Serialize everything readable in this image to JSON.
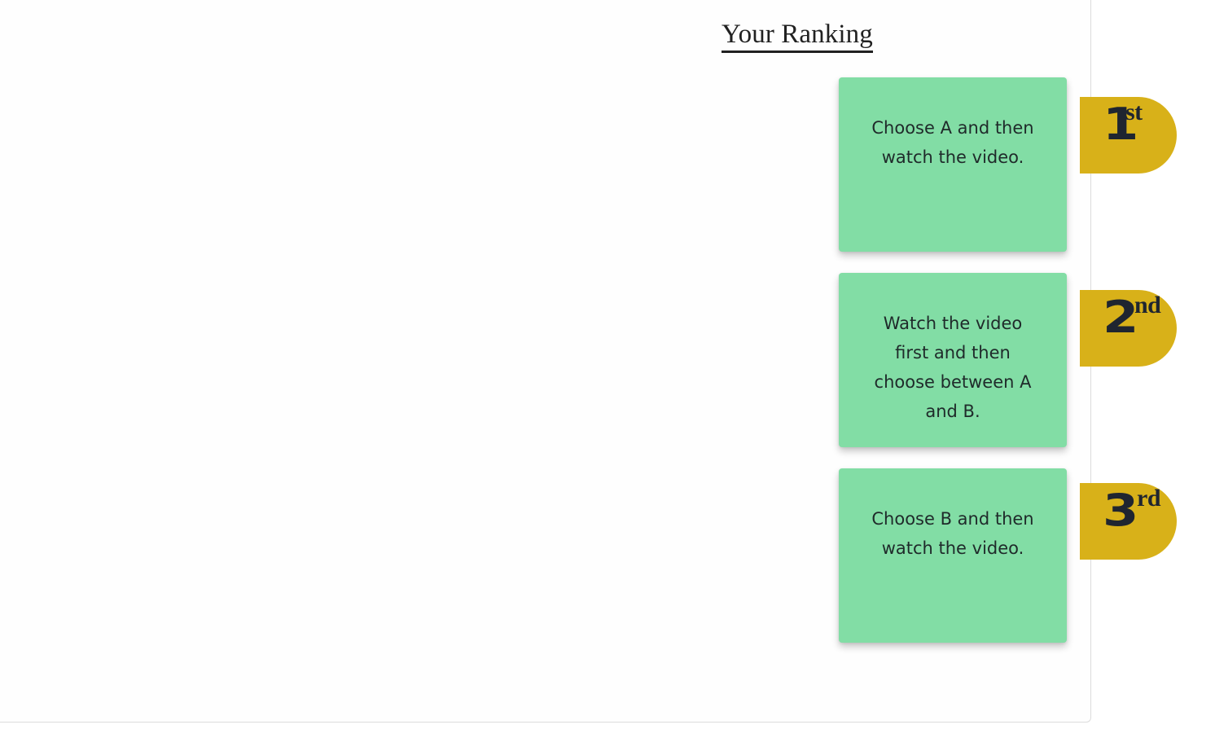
{
  "ranking": {
    "title": "Your Ranking",
    "items": [
      {
        "text": "Choose A and then watch the video.",
        "rank_number": "1",
        "rank_suffix": "st"
      },
      {
        "text": "Watch the video first and then choose between A and B.",
        "rank_number": "2",
        "rank_suffix": "nd"
      },
      {
        "text": "Choose B and then watch the video.",
        "rank_number": "3",
        "rank_suffix": "rd"
      }
    ]
  },
  "colors": {
    "card": "#82dda5",
    "badge": "#d8b119",
    "text": "#1f2a2a"
  }
}
